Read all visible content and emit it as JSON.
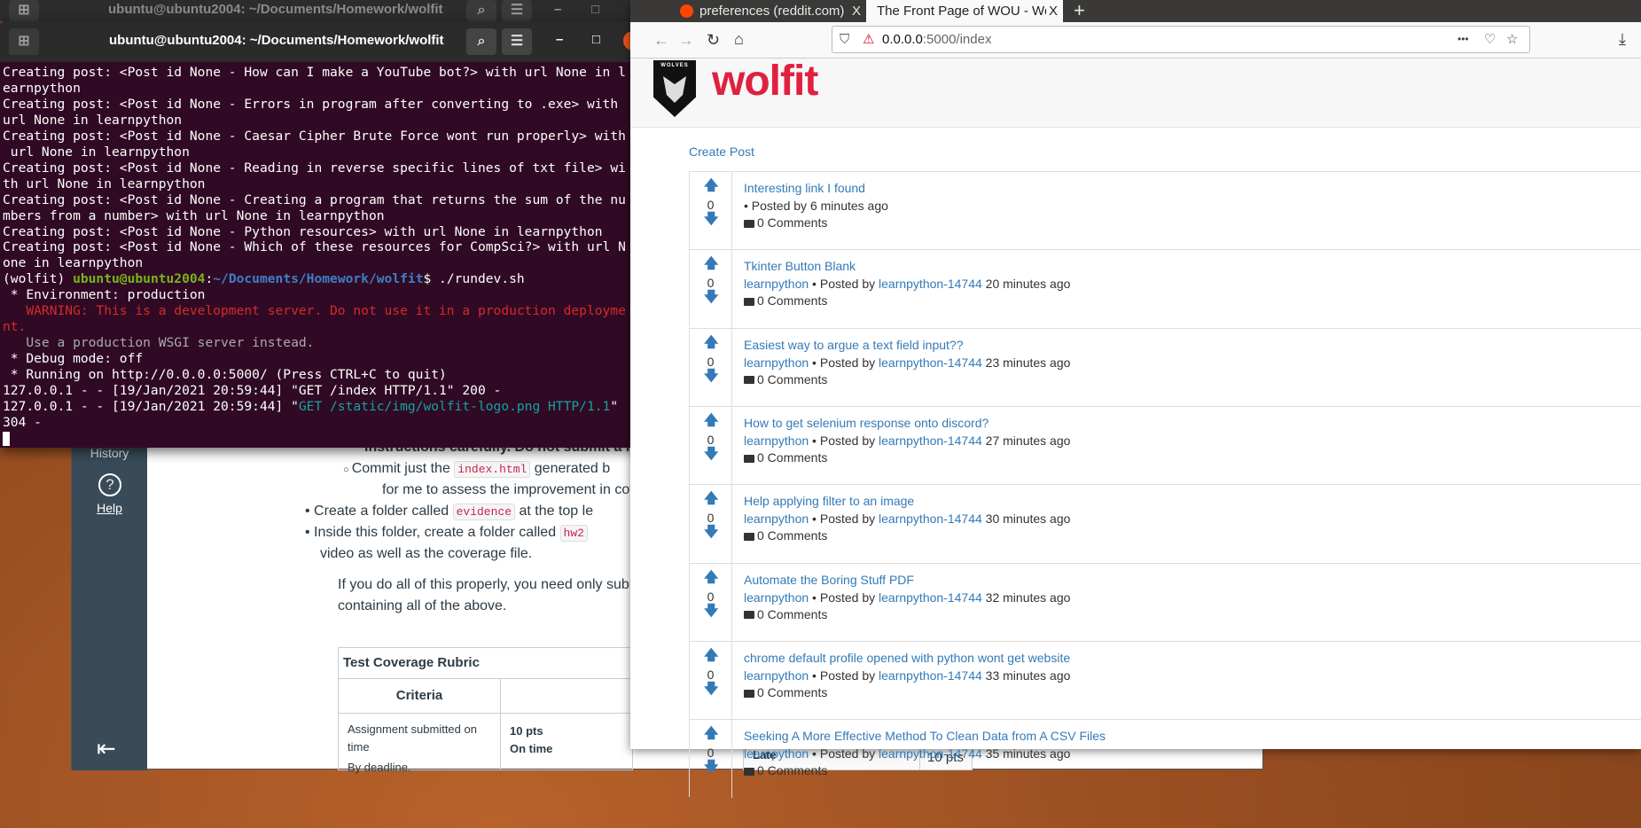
{
  "back_terminal": {
    "title": "ubuntu@ubuntu2004: ~/Documents/Homework/wolfit"
  },
  "canvas": {
    "sidebar": {
      "history": "History",
      "help": "Help"
    },
    "lines": {
      "l1": "instructions carefully. Do not submit a l",
      "l2a": "Commit just the",
      "l2code": "index.html",
      "l2b": "generated b",
      "l3": "for me to assess the improvement in cov",
      "l4a": "Create a folder called",
      "l4code": "evidence",
      "l4b": "at the top le",
      "l5a": "Inside this folder, create a folder called",
      "l5code": "hw2",
      "l6": "video as well as the coverage file.",
      "p1": "If you do all of this properly, you need only subr",
      "p2": "containing all of the above."
    },
    "rubric": {
      "title": "Test Coverage Rubric",
      "criteria": "Criteria",
      "row_desc": "Assignment submitted on time",
      "row_sub": "By deadline.",
      "pts": "10 pts",
      "rating": "On time",
      "late": "Late",
      "late_pts": "10 pts"
    }
  },
  "terminal": {
    "title": "ubuntu@ubuntu2004: ~/Documents/Homework/wolfit",
    "lines": [
      "Creating post: <Post id None - How can I make a YouTube bot?> with url None in l",
      "earnpython",
      "Creating post: <Post id None - Errors in program after converting to .exe> with",
      "url None in learnpython",
      "Creating post: <Post id None - Caesar Cipher Brute Force wont run properly> with",
      " url None in learnpython",
      "Creating post: <Post id None - Reading in reverse specific lines of txt file> wi",
      "th url None in learnpython",
      "Creating post: <Post id None - Creating a program that returns the sum of the nu",
      "mbers from a number> with url None in learnpython",
      "Creating post: <Post id None - Python resources> with url None in learnpython",
      "Creating post: <Post id None - Which of these resources for CompSci?> with url N",
      "one in learnpython"
    ],
    "prompt": {
      "env": "(wolfit) ",
      "user": "ubuntu@ubuntu2004",
      "colon": ":",
      "path": "~/Documents/Homework/wolfit",
      "cmd": "$ ./rundev.sh"
    },
    "env_line": " * Environment: production",
    "warning": "   WARNING: This is a development server. Do not use it in a production deployme",
    "warning2": "nt.",
    "use_wsgi": "   Use a production WSGI server instead.",
    "debug": " * Debug mode: off",
    "running": " * Running on http://0.0.0.0:5000/ (Press CTRL+C to quit)",
    "log1": "127.0.0.1 - - [19/Jan/2021 20:59:44] \"GET /index HTTP/1.1\" 200 -",
    "log2a": "127.0.0.1 - - [19/Jan/2021 20:59:44] \"",
    "log2b": "GET /static/img/wolfit-logo.png HTTP/1.1",
    "log2c": "\"",
    "log3": "304 -"
  },
  "browser": {
    "tabs": [
      {
        "label": "preferences (reddit.com)"
      },
      {
        "label": "The Front Page of WOU - Wo"
      }
    ],
    "url_host": "0.0.0.0",
    "url_rest": ":5000/index",
    "url_more": "•••"
  },
  "site": {
    "logo_text": "wolfit",
    "logo_badge": "WOLVES",
    "brand_color": "#e0203f",
    "link_color": "#337ab7",
    "create_post": "Create Post",
    "posted_by": "Posted by",
    "comments": "0 Comments",
    "posts": [
      {
        "title": "Interesting link I found",
        "sub": "",
        "author": "",
        "age": "6 minutes ago",
        "score": "0"
      },
      {
        "title": "Tkinter Button Blank",
        "sub": "learnpython",
        "author": "learnpython-14744",
        "age": "20 minutes ago",
        "score": "0"
      },
      {
        "title": "Easiest way to argue a text field input??",
        "sub": "learnpython",
        "author": "learnpython-14744",
        "age": "23 minutes ago",
        "score": "0"
      },
      {
        "title": "How to get selenium response onto discord?",
        "sub": "learnpython",
        "author": "learnpython-14744",
        "age": "27 minutes ago",
        "score": "0"
      },
      {
        "title": "Help applying filter to an image",
        "sub": "learnpython",
        "author": "learnpython-14744",
        "age": "30 minutes ago",
        "score": "0"
      },
      {
        "title": "Automate the Boring Stuff PDF",
        "sub": "learnpython",
        "author": "learnpython-14744",
        "age": "32 minutes ago",
        "score": "0"
      },
      {
        "title": "chrome default profile opened with python wont get website",
        "sub": "learnpython",
        "author": "learnpython-14744",
        "age": "33 minutes ago",
        "score": "0"
      },
      {
        "title": "Seeking A More Effective Method To Clean Data from A CSV Files",
        "sub": "learnpython",
        "author": "learnpython-14744",
        "age": "35 minutes ago",
        "score": "0"
      }
    ]
  }
}
